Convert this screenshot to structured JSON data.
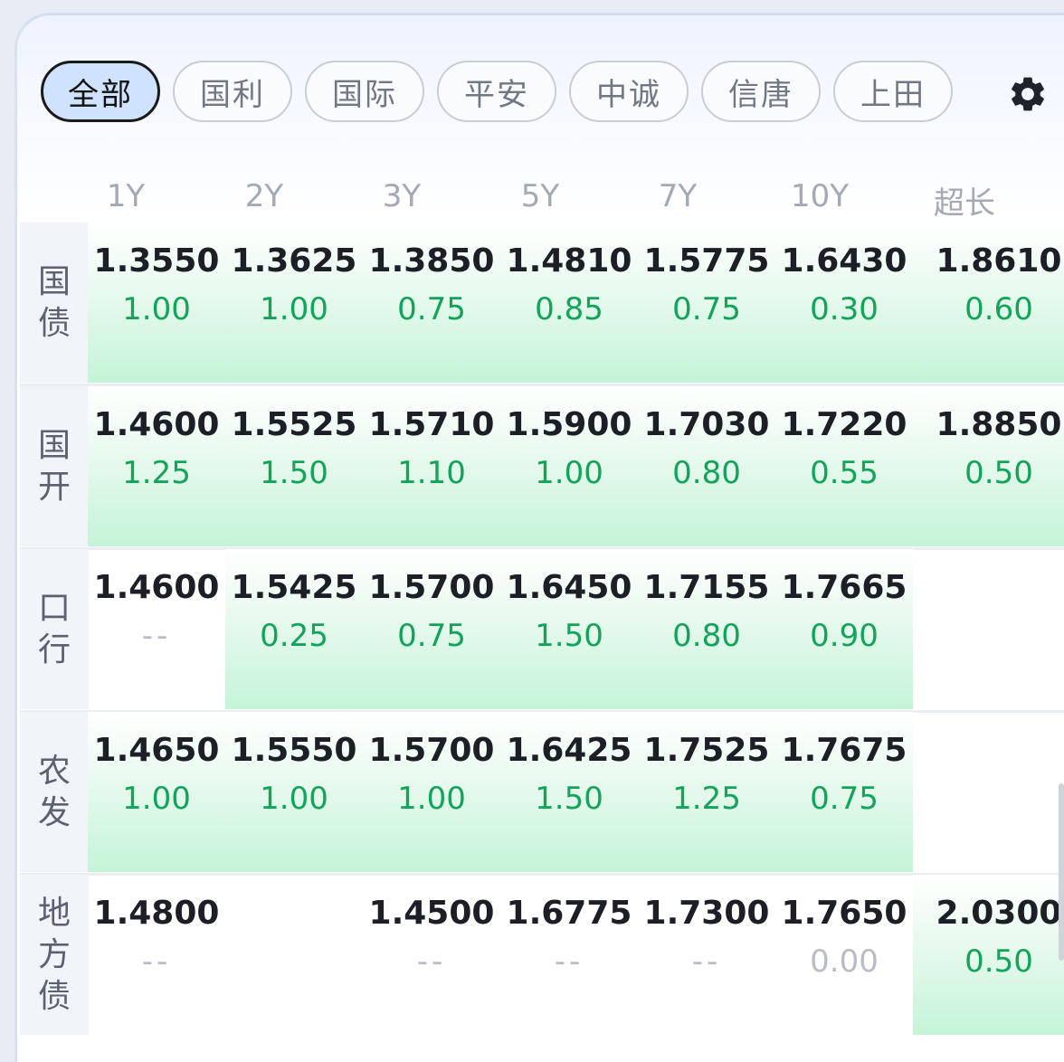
{
  "tabs": [
    {
      "label": "全部",
      "active": true
    },
    {
      "label": "国利",
      "active": false
    },
    {
      "label": "国际",
      "active": false
    },
    {
      "label": "平安",
      "active": false
    },
    {
      "label": "中诚",
      "active": false
    },
    {
      "label": "信唐",
      "active": false
    },
    {
      "label": "上田",
      "active": false
    }
  ],
  "columns": [
    "1Y",
    "2Y",
    "3Y",
    "5Y",
    "7Y",
    "10Y",
    "超长"
  ],
  "rows": [
    {
      "label": [
        "国",
        "债"
      ],
      "cells": [
        {
          "value": "1.3550",
          "change": "1.00",
          "hl": true
        },
        {
          "value": "1.3625",
          "change": "1.00",
          "hl": true
        },
        {
          "value": "1.3850",
          "change": "0.75",
          "hl": true
        },
        {
          "value": "1.4810",
          "change": "0.85",
          "hl": true
        },
        {
          "value": "1.5775",
          "change": "0.75",
          "hl": true
        },
        {
          "value": "1.6430",
          "change": "0.30",
          "hl": true
        },
        {
          "value": "1.8610",
          "change": "0.60",
          "hl": true
        }
      ]
    },
    {
      "label": [
        "国",
        "开"
      ],
      "cells": [
        {
          "value": "1.4600",
          "change": "1.25",
          "hl": true
        },
        {
          "value": "1.5525",
          "change": "1.50",
          "hl": true
        },
        {
          "value": "1.5710",
          "change": "1.10",
          "hl": true
        },
        {
          "value": "1.5900",
          "change": "1.00",
          "hl": true
        },
        {
          "value": "1.7030",
          "change": "0.80",
          "hl": true
        },
        {
          "value": "1.7220",
          "change": "0.55",
          "hl": true
        },
        {
          "value": "1.8850",
          "change": "0.50",
          "hl": true
        }
      ]
    },
    {
      "label": [
        "口",
        "行"
      ],
      "cells": [
        {
          "value": "1.4600",
          "change": "--",
          "hl": false
        },
        {
          "value": "1.5425",
          "change": "0.25",
          "hl": true
        },
        {
          "value": "1.5700",
          "change": "0.75",
          "hl": true
        },
        {
          "value": "1.6450",
          "change": "1.50",
          "hl": true
        },
        {
          "value": "1.7155",
          "change": "0.80",
          "hl": true
        },
        {
          "value": "1.7665",
          "change": "0.90",
          "hl": true
        },
        {
          "value": "",
          "change": "",
          "hl": false
        }
      ]
    },
    {
      "label": [
        "农",
        "发"
      ],
      "cells": [
        {
          "value": "1.4650",
          "change": "1.00",
          "hl": true
        },
        {
          "value": "1.5550",
          "change": "1.00",
          "hl": true
        },
        {
          "value": "1.5700",
          "change": "1.00",
          "hl": true
        },
        {
          "value": "1.6425",
          "change": "1.50",
          "hl": true
        },
        {
          "value": "1.7525",
          "change": "1.25",
          "hl": true
        },
        {
          "value": "1.7675",
          "change": "0.75",
          "hl": true
        },
        {
          "value": "",
          "change": "",
          "hl": false
        }
      ]
    },
    {
      "label": [
        "地",
        "方",
        "债"
      ],
      "cells": [
        {
          "value": "1.4800",
          "change": "--",
          "hl": false
        },
        {
          "value": "",
          "change": "",
          "hl": false
        },
        {
          "value": "1.4500",
          "change": "--",
          "hl": false
        },
        {
          "value": "1.6775",
          "change": "--",
          "hl": false
        },
        {
          "value": "1.7300",
          "change": "--",
          "hl": false
        },
        {
          "value": "1.7650",
          "change": "0.00",
          "hl": false
        },
        {
          "value": "2.0300",
          "change": "0.50",
          "hl": true
        }
      ]
    }
  ],
  "colors": {
    "positive": "#13a35a",
    "neutral": "#b7bcc6",
    "active_tab": "#cfe3ff"
  },
  "icons": {
    "settings": "gear-icon"
  }
}
